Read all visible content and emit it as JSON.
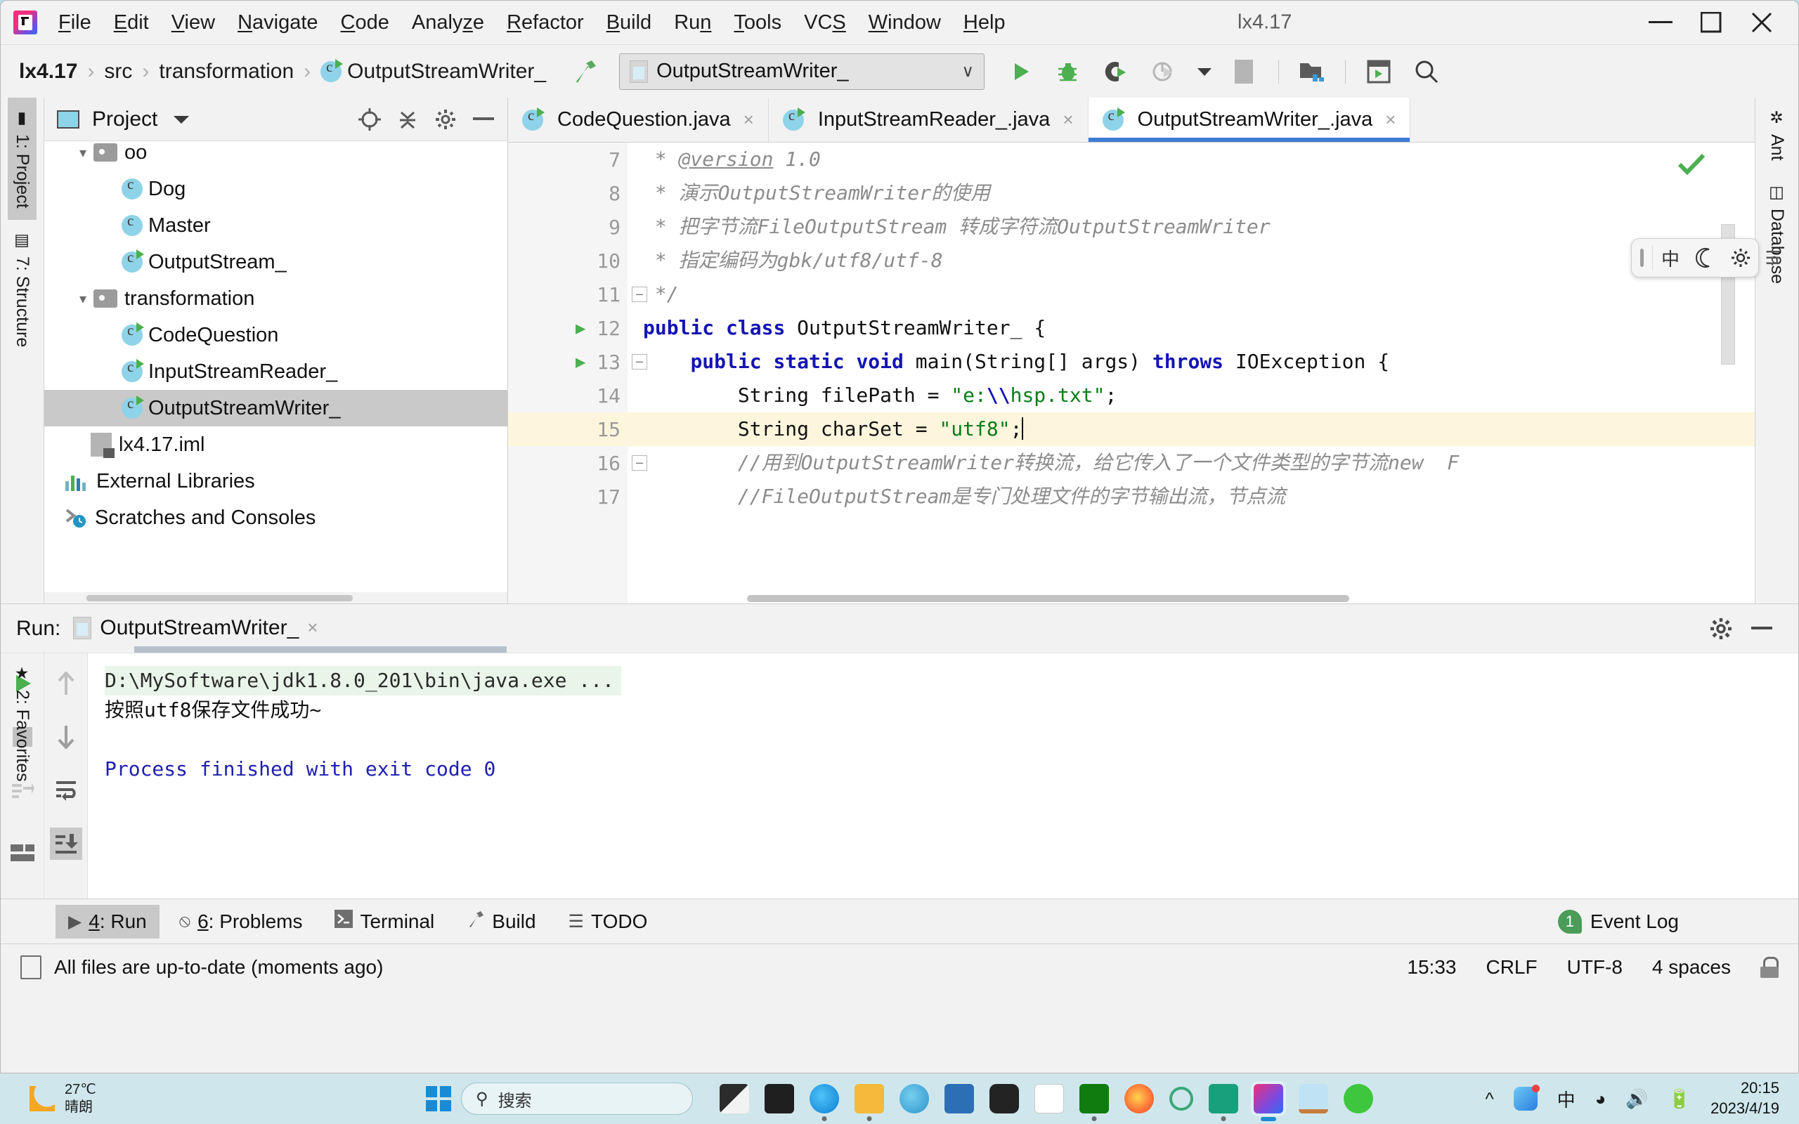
{
  "window": {
    "title": "lx4.17",
    "logo_icon": "intellij-idea-logo",
    "minimize_icon": "minimize-icon",
    "maximize_icon": "maximize-icon",
    "close_icon": "close-icon"
  },
  "menubar": [
    {
      "label": "File",
      "mnemonic": "F"
    },
    {
      "label": "Edit",
      "mnemonic": "E"
    },
    {
      "label": "View",
      "mnemonic": "V"
    },
    {
      "label": "Navigate",
      "mnemonic": "N"
    },
    {
      "label": "Code",
      "mnemonic": "C"
    },
    {
      "label": "Analyze",
      "mnemonic": "z"
    },
    {
      "label": "Refactor",
      "mnemonic": "R"
    },
    {
      "label": "Build",
      "mnemonic": "B"
    },
    {
      "label": "Run",
      "mnemonic": "n"
    },
    {
      "label": "Tools",
      "mnemonic": "T"
    },
    {
      "label": "VCS",
      "mnemonic": "S"
    },
    {
      "label": "Window",
      "mnemonic": "W"
    },
    {
      "label": "Help",
      "mnemonic": "H"
    }
  ],
  "navbar": {
    "breadcrumbs": [
      "lx4.17",
      "src",
      "transformation",
      "OutputStreamWriter_"
    ],
    "separator": "›",
    "build_icon": "build-hammer-icon",
    "run_config": {
      "name": "OutputStreamWriter_",
      "chevron": "∨",
      "app_icon": "run-configuration-icon"
    },
    "toolbar_icons": [
      "run-icon",
      "debug-icon",
      "run-with-coverage-icon",
      "profiler-icon",
      "profiler-dropdown-icon",
      "stop-icon",
      "project-structure-icon",
      "terminal-icon",
      "search-everywhere-icon"
    ]
  },
  "left_rail": [
    {
      "label": "1: Project",
      "icon": "project-folder-icon",
      "active": true
    },
    {
      "label": "7: Structure",
      "icon": "structure-icon",
      "active": false
    },
    {
      "label": "2: Favorites",
      "icon": "star-icon",
      "active": false
    }
  ],
  "right_rail": [
    {
      "label": "Ant",
      "icon": "ant-icon"
    },
    {
      "label": "Database",
      "icon": "database-icon"
    }
  ],
  "project_panel": {
    "title": "Project",
    "dropdown_icon": "chevron-down-icon",
    "locate_icon": "scroll-from-source-icon",
    "collapse_icon": "collapse-all-icon",
    "settings_icon": "gear-icon",
    "hide_icon": "hide-icon",
    "tree": [
      {
        "label": "oo",
        "type": "folder",
        "indent": 1,
        "expanded": true,
        "selected": false,
        "clipped": true
      },
      {
        "label": "Dog",
        "type": "class",
        "indent": 2,
        "selected": false,
        "runnable": false
      },
      {
        "label": "Master",
        "type": "class",
        "indent": 2,
        "selected": false,
        "runnable": false
      },
      {
        "label": "OutputStream_",
        "type": "class",
        "indent": 2,
        "selected": false,
        "runnable": true
      },
      {
        "label": "transformation",
        "type": "folder",
        "indent": 1,
        "expanded": true,
        "selected": false
      },
      {
        "label": "CodeQuestion",
        "type": "class",
        "indent": 2,
        "selected": false,
        "runnable": true
      },
      {
        "label": "InputStreamReader_",
        "type": "class",
        "indent": 2,
        "selected": false,
        "runnable": true
      },
      {
        "label": "OutputStreamWriter_",
        "type": "class",
        "indent": 2,
        "selected": true,
        "runnable": true
      },
      {
        "label": "lx4.17.iml",
        "type": "iml",
        "indent": 1,
        "selected": false
      },
      {
        "label": "External Libraries",
        "type": "library",
        "indent": 0,
        "selected": false
      },
      {
        "label": "Scratches and Consoles",
        "type": "scratch",
        "indent": 0,
        "selected": false
      }
    ]
  },
  "editor": {
    "tabs": [
      {
        "label": "CodeQuestion.java",
        "active": false,
        "icon": "java-class-runnable-icon",
        "close": "×"
      },
      {
        "label": "InputStreamReader_.java",
        "active": false,
        "icon": "java-class-runnable-icon",
        "close": "×"
      },
      {
        "label": "OutputStreamWriter_.java",
        "active": true,
        "icon": "java-class-runnable-icon",
        "close": "×"
      }
    ],
    "inspection_status_icon": "inspections-ok-check",
    "lines": [
      {
        "num": "7",
        "runmark": false,
        "fold": false,
        "highlight": false
      },
      {
        "num": "8",
        "runmark": false,
        "fold": false,
        "highlight": false
      },
      {
        "num": "9",
        "runmark": false,
        "fold": false,
        "highlight": false
      },
      {
        "num": "10",
        "runmark": false,
        "fold": false,
        "highlight": false
      },
      {
        "num": "11",
        "runmark": false,
        "fold": true,
        "highlight": false
      },
      {
        "num": "12",
        "runmark": true,
        "fold": false,
        "highlight": false
      },
      {
        "num": "13",
        "runmark": true,
        "fold": true,
        "highlight": false
      },
      {
        "num": "14",
        "runmark": false,
        "fold": false,
        "highlight": false
      },
      {
        "num": "15",
        "runmark": false,
        "fold": false,
        "highlight": true
      },
      {
        "num": "16",
        "runmark": false,
        "fold": true,
        "highlight": false
      },
      {
        "num": "17",
        "runmark": false,
        "fold": false,
        "highlight": false
      }
    ],
    "code_text": {
      "l7_star": " * ",
      "l7_tag": "@version",
      "l7_rest": " 1.0",
      "l8": " * 演示OutputStreamWriter的使用",
      "l9": " * 把字节流FileOutputStream 转成字符流OutputStreamWriter",
      "l10": " * 指定编码为gbk/utf8/utf-8",
      "l11": " */",
      "l12_kw1": "public",
      "l12_kw2": "class",
      "l12_name": " OutputStreamWriter_ {",
      "l13_kw": "public static void",
      "l13_mid": " main(String[] args) ",
      "l13_throws": "throws",
      "l13_end": " IOException {",
      "l14_pre": "        String filePath = ",
      "l14_str1": "\"e:",
      "l14_esc": "\\\\",
      "l14_str2": "hsp.txt\"",
      "l14_end": ";",
      "l15_pre": "        String charSet = ",
      "l15_str": "\"utf8\"",
      "l15_end": ";",
      "l16": "        //用到OutputStreamWriter转换流，给它传入了一个文件类型的字节流new  F",
      "l17": "        //FileOutputStream是专门处理文件的字节输出流，节点流"
    }
  },
  "ime_toolbar": {
    "grip_icon": "drag-grip-icon",
    "items": [
      {
        "icon": "chinese-mode-icon",
        "glyph": "中"
      },
      {
        "icon": "moon-icon",
        "glyph": "☽"
      },
      {
        "icon": "gear-icon",
        "glyph": "⚙"
      }
    ],
    "menu_icon": "hamburger-menu-icon",
    "menu_glyph": "☰"
  },
  "run_panel": {
    "label": "Run:",
    "tab_name": "OutputStreamWriter_",
    "tab_close": "×",
    "settings_icon": "gear-icon",
    "hide_icon": "hide-icon",
    "left_tools": [
      {
        "icon": "rerun-icon",
        "glyph": "▶",
        "active": false
      },
      {
        "icon": "stop-icon",
        "glyph": "■",
        "active": false
      },
      {
        "icon": "dump-threads-icon",
        "glyph": "☴",
        "active": false
      },
      {
        "icon": "layout-icon",
        "glyph": "▤",
        "active": false
      }
    ],
    "right_tools": [
      {
        "icon": "up-arrow-icon",
        "glyph": "↑",
        "active": false
      },
      {
        "icon": "down-arrow-icon",
        "glyph": "↓",
        "active": false
      },
      {
        "icon": "soft-wrap-icon",
        "glyph": "↩",
        "active": false
      },
      {
        "icon": "scroll-to-end-icon",
        "glyph": "⤓",
        "active": true
      }
    ],
    "console": [
      {
        "text": "D:\\MySoftware\\jdk1.8.0_201\\bin\\java.exe ...",
        "kind": "cmd"
      },
      {
        "text": "按照utf8保存文件成功~",
        "kind": "out"
      },
      {
        "text": "",
        "kind": "out"
      },
      {
        "text": "Process finished with exit code 0",
        "kind": "fin"
      }
    ]
  },
  "bottom_bar": {
    "buttons": [
      {
        "label": "4: Run",
        "mnemonic": "4",
        "icon": "run-icon",
        "active": true
      },
      {
        "label": "6: Problems",
        "mnemonic": "6",
        "icon": "problems-icon",
        "active": false
      },
      {
        "label": "Terminal",
        "mnemonic": "",
        "icon": "terminal-icon",
        "active": false
      },
      {
        "label": "Build",
        "mnemonic": "",
        "icon": "build-hammer-icon",
        "active": false
      },
      {
        "label": "TODO",
        "mnemonic": "",
        "icon": "todo-list-icon",
        "active": false
      }
    ],
    "event_log": {
      "label": "Event Log",
      "count": "1"
    }
  },
  "status_bar": {
    "message": "All files are up-to-date (moments ago)",
    "doc_icon": "document-icon",
    "time": "15:33",
    "line_separator": "CRLF",
    "encoding": "UTF-8",
    "indent": "4 spaces",
    "lock_icon": "unlocked-icon"
  },
  "taskbar": {
    "weather": {
      "temp": "27℃",
      "desc": "晴朗",
      "icon": "moon-weather-icon"
    },
    "start_icon": "windows-start-icon",
    "search": {
      "placeholder": "搜索",
      "icon": "search-icon"
    },
    "apps": [
      {
        "name": "task-view-icon",
        "color": "#2b2b2b",
        "running": false
      },
      {
        "name": "sublime-text-icon",
        "color": "#1f1f1f",
        "running": false
      },
      {
        "name": "edge-icon",
        "color": "#0b7fd4",
        "running": true
      },
      {
        "name": "file-explorer-icon",
        "color": "#f5b93b",
        "running": true
      },
      {
        "name": "edge-dev-icon",
        "color": "#3aa3d9",
        "running": false
      },
      {
        "name": "microsoft-store-icon",
        "color": "#2d6fb5",
        "running": false
      },
      {
        "name": "game-launcher-icon",
        "color": "#232323",
        "running": false
      },
      {
        "name": "document-icon",
        "color": "#ffffff",
        "running": false
      },
      {
        "name": "xbox-icon",
        "color": "#107c10",
        "running": true
      },
      {
        "name": "firefox-icon",
        "color": "#ff7139",
        "running": false
      },
      {
        "name": "search-tool-icon",
        "color": "#3aa87a",
        "running": false
      },
      {
        "name": "wps-icon",
        "color": "#18a07a",
        "running": true
      },
      {
        "name": "intellij-idea-icon",
        "color": "#f0307e",
        "running": true,
        "active": true
      },
      {
        "name": "notepad-icon",
        "color": "#4aa3df",
        "running": false
      },
      {
        "name": "wechat-icon",
        "color": "#3ec63e",
        "running": false
      }
    ],
    "tray": {
      "expand_icon": "chevron-up-icon",
      "ime_app_icon": "ime-app-icon",
      "ime_mode": "中",
      "wifi_icon": "wifi-icon",
      "volume_icon": "volume-icon",
      "battery_icon": "battery-charging-icon",
      "time": "20:15",
      "date": "2023/4/19"
    }
  }
}
